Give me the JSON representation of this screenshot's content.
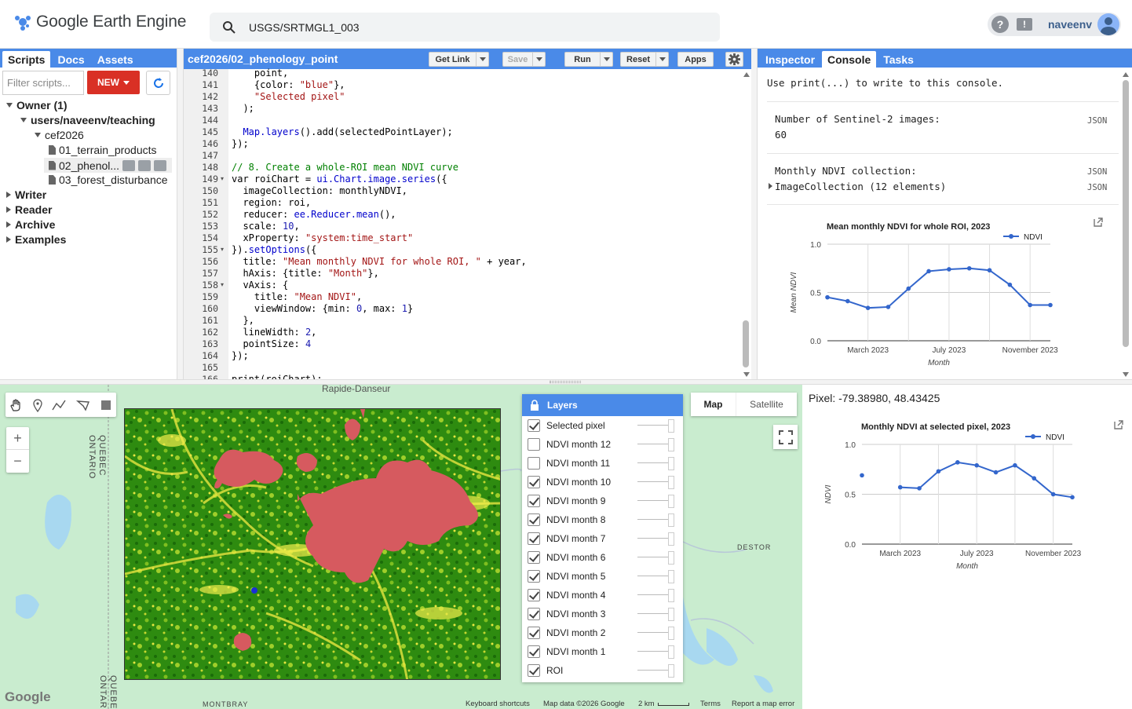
{
  "app": {
    "title": "Google Earth Engine"
  },
  "search": {
    "value": "USGS/SRTMGL1_003"
  },
  "user": {
    "name": "naveenv",
    "help_icon": "?",
    "feedback_icon": "!"
  },
  "left_panel": {
    "tabs": [
      "Scripts",
      "Docs",
      "Assets"
    ],
    "filter_placeholder": "Filter scripts...",
    "new_label": "NEW",
    "tree": {
      "owner": "Owner (1)",
      "repo": "users/naveenv/teaching",
      "folder": "cef2026",
      "files": [
        "01_terrain_products",
        "02_phenol...",
        "03_forest_disturbance"
      ],
      "groups": [
        "Writer",
        "Reader",
        "Archive",
        "Examples"
      ]
    }
  },
  "editor": {
    "script_title": "cef2026/02_phenology_point",
    "buttons": {
      "get_link": "Get Link",
      "save": "Save",
      "run": "Run",
      "reset": "Reset",
      "apps": "Apps"
    },
    "lines": [
      {
        "n": "140",
        "parts": [
          [
            "point,",
            "kw"
          ]
        ],
        "indent": "    "
      },
      {
        "n": "141",
        "parts": [
          [
            "{color: ",
            "kw"
          ],
          [
            "\"blue\"",
            "str"
          ],
          [
            "},",
            "kw"
          ]
        ],
        "indent": "    "
      },
      {
        "n": "142",
        "parts": [
          [
            "\"Selected pixel\"",
            "str"
          ]
        ],
        "indent": "    "
      },
      {
        "n": "143",
        "parts": [
          [
            ");",
            "kw"
          ]
        ],
        "indent": "  "
      },
      {
        "n": "144",
        "parts": [],
        "indent": ""
      },
      {
        "n": "145",
        "parts": [
          [
            "Map.layers",
            "fn"
          ],
          [
            "().add(selectedPointLayer);",
            "kw"
          ]
        ],
        "indent": "  "
      },
      {
        "n": "146",
        "parts": [
          [
            "});",
            "kw"
          ]
        ],
        "indent": ""
      },
      {
        "n": "147",
        "parts": [],
        "indent": ""
      },
      {
        "n": "148",
        "parts": [
          [
            "// 8. Create a whole-ROI mean NDVI curve",
            "cm"
          ]
        ],
        "indent": ""
      },
      {
        "n": "149",
        "parts": [
          [
            "var roiChart = ",
            "kw"
          ],
          [
            "ui.Chart.image.series",
            "fn"
          ],
          [
            "({",
            "kw"
          ]
        ],
        "indent": "",
        "fold": true
      },
      {
        "n": "150",
        "parts": [
          [
            "imageCollection: monthlyNDVI,",
            "kw"
          ]
        ],
        "indent": "  "
      },
      {
        "n": "151",
        "parts": [
          [
            "region: roi,",
            "kw"
          ]
        ],
        "indent": "  "
      },
      {
        "n": "152",
        "parts": [
          [
            "reducer: ",
            "kw"
          ],
          [
            "ee.Reducer.mean",
            "fn"
          ],
          [
            "(),",
            "kw"
          ]
        ],
        "indent": "  "
      },
      {
        "n": "153",
        "parts": [
          [
            "scale: ",
            "kw"
          ],
          [
            "10",
            "num"
          ],
          [
            ",",
            "kw"
          ]
        ],
        "indent": "  "
      },
      {
        "n": "154",
        "parts": [
          [
            "xProperty: ",
            "kw"
          ],
          [
            "\"system:time_start\"",
            "str"
          ]
        ],
        "indent": "  "
      },
      {
        "n": "155",
        "parts": [
          [
            "}).",
            "kw"
          ],
          [
            "setOptions",
            "fn"
          ],
          [
            "({",
            "kw"
          ]
        ],
        "indent": "",
        "fold": true
      },
      {
        "n": "156",
        "parts": [
          [
            "title: ",
            "kw"
          ],
          [
            "\"Mean monthly NDVI for whole ROI, \"",
            "str"
          ],
          [
            " + year,",
            "kw"
          ]
        ],
        "indent": "  "
      },
      {
        "n": "157",
        "parts": [
          [
            "hAxis: {title: ",
            "kw"
          ],
          [
            "\"Month\"",
            "str"
          ],
          [
            "},",
            "kw"
          ]
        ],
        "indent": "  "
      },
      {
        "n": "158",
        "parts": [
          [
            "vAxis: {",
            "kw"
          ]
        ],
        "indent": "  ",
        "fold": true
      },
      {
        "n": "159",
        "parts": [
          [
            "title: ",
            "kw"
          ],
          [
            "\"Mean NDVI\"",
            "str"
          ],
          [
            ",",
            "kw"
          ]
        ],
        "indent": "    "
      },
      {
        "n": "160",
        "parts": [
          [
            "viewWindow: {min: ",
            "kw"
          ],
          [
            "0",
            "num"
          ],
          [
            ", max: ",
            "kw"
          ],
          [
            "1",
            "num"
          ],
          [
            "}",
            "kw"
          ]
        ],
        "indent": "    "
      },
      {
        "n": "161",
        "parts": [
          [
            "},",
            "kw"
          ]
        ],
        "indent": "  "
      },
      {
        "n": "162",
        "parts": [
          [
            "lineWidth: ",
            "kw"
          ],
          [
            "2",
            "num"
          ],
          [
            ",",
            "kw"
          ]
        ],
        "indent": "  "
      },
      {
        "n": "163",
        "parts": [
          [
            "pointSize: ",
            "kw"
          ],
          [
            "4",
            "num"
          ]
        ],
        "indent": "  "
      },
      {
        "n": "164",
        "parts": [
          [
            "});",
            "kw"
          ]
        ],
        "indent": ""
      },
      {
        "n": "165",
        "parts": [],
        "indent": ""
      },
      {
        "n": "166",
        "parts": [
          [
            "print(roiChart);",
            "kw"
          ]
        ],
        "indent": ""
      }
    ]
  },
  "right_panel": {
    "tabs": [
      "Inspector",
      "Console",
      "Tasks"
    ],
    "console_hint": "Use print(...) to write to this console.",
    "entries": [
      {
        "label": "Number of Sentinel-2 images:",
        "value": "60",
        "tag": "JSON"
      },
      {
        "label": "Monthly NDVI collection:",
        "value": "ImageCollection (12 elements)",
        "tag": "JSON",
        "tag2": "JSON"
      }
    ]
  },
  "chart_data": [
    {
      "type": "line",
      "title": "Mean monthly NDVI for whole ROI, 2023",
      "xlabel": "Month",
      "ylabel": "Mean NDVI",
      "x_ticks": [
        "March 2023",
        "July 2023",
        "November 2023"
      ],
      "y_ticks": [
        "1.0",
        "0.5",
        "0.0"
      ],
      "ylim": [
        0,
        1
      ],
      "legend": "top-right",
      "x": [
        "2023-01",
        "2023-02",
        "2023-03",
        "2023-04",
        "2023-05",
        "2023-06",
        "2023-07",
        "2023-08",
        "2023-09",
        "2023-10",
        "2023-11",
        "2023-12"
      ],
      "series": [
        {
          "name": "NDVI",
          "values": [
            0.45,
            0.41,
            0.34,
            0.35,
            0.54,
            0.72,
            0.74,
            0.75,
            0.73,
            0.58,
            0.37,
            0.37
          ]
        }
      ],
      "color": "#3366cc"
    },
    {
      "type": "line",
      "title": "Monthly NDVI at selected pixel, 2023",
      "xlabel": "Month",
      "ylabel": "NDVI",
      "x_ticks": [
        "March 2023",
        "July 2023",
        "November 2023"
      ],
      "y_ticks": [
        "1.0",
        "0.5",
        "0.0"
      ],
      "ylim": [
        0,
        1
      ],
      "legend": "top-right",
      "x": [
        "2023-01",
        "2023-02",
        "2023-03",
        "2023-04",
        "2023-05",
        "2023-06",
        "2023-07",
        "2023-08",
        "2023-09",
        "2023-10",
        "2023-11",
        "2023-12"
      ],
      "series": [
        {
          "name": "NDVI",
          "values": [
            0.69,
            null,
            0.57,
            0.56,
            0.73,
            0.82,
            0.79,
            0.72,
            0.79,
            0.66,
            0.5,
            0.47
          ]
        }
      ],
      "color": "#3366cc"
    }
  ],
  "map": {
    "labels": {
      "top": "Rapide-Danseur",
      "quebec": "QUEBEC",
      "ontario": "ONTARIO",
      "destor": "DESTOR",
      "montbray": "MONTBRAY"
    },
    "layers_title": "Layers",
    "layers": [
      {
        "name": "Selected pixel",
        "checked": true
      },
      {
        "name": "NDVI month 12",
        "checked": false
      },
      {
        "name": "NDVI month 11",
        "checked": false
      },
      {
        "name": "NDVI month 10",
        "checked": true
      },
      {
        "name": "NDVI month 9",
        "checked": true
      },
      {
        "name": "NDVI month 8",
        "checked": true
      },
      {
        "name": "NDVI month 7",
        "checked": true
      },
      {
        "name": "NDVI month 6",
        "checked": true
      },
      {
        "name": "NDVI month 5",
        "checked": true
      },
      {
        "name": "NDVI month 4",
        "checked": true
      },
      {
        "name": "NDVI month 3",
        "checked": true
      },
      {
        "name": "NDVI month 2",
        "checked": true
      },
      {
        "name": "NDVI month 1",
        "checked": true
      },
      {
        "name": "ROI",
        "checked": true
      }
    ],
    "map_type": {
      "map": "Map",
      "satellite": "Satellite"
    },
    "footer": {
      "keyboard": "Keyboard shortcuts",
      "data": "Map data ©2026 Google",
      "scale": "2 km",
      "terms": "Terms",
      "report": "Report a map error",
      "google": "Google"
    },
    "zoom_in": "+",
    "zoom_out": "−"
  },
  "pixel_panel": {
    "coords": "Pixel: -79.38980, 48.43425"
  },
  "colors": {
    "accent": "#4a8ae8",
    "new_button": "#d93025",
    "series": "#3366cc",
    "burn": "#d65a5f"
  }
}
